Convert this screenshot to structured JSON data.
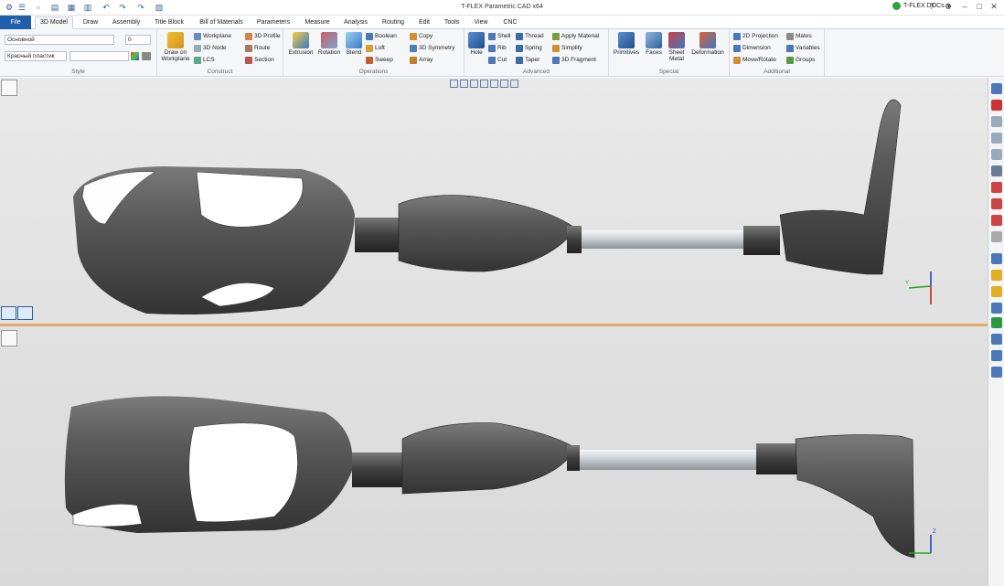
{
  "app_title": "T-FLEX Parametric CAD x64",
  "docs_label": "T-FLEX DOCs",
  "tabs": [
    "File",
    "3D Model",
    "Draw",
    "Assembly",
    "Title Block",
    "Bill of Materials",
    "Parameters",
    "Measure",
    "Analysis",
    "Routing",
    "Edit",
    "Tools",
    "View",
    "CNC"
  ],
  "active_tab": "3D Model",
  "style": {
    "layer": "Основной",
    "layer_num": "0",
    "material": "Красный пластик",
    "label": "Style"
  },
  "construct": {
    "big": "Draw on Workplane",
    "items": [
      "Workplane",
      "3D Node",
      "LCS",
      "3D Profile",
      "Route",
      "Section"
    ],
    "label": "Construct"
  },
  "operations": {
    "big": [
      "Extrusion",
      "Rotation",
      "Blend"
    ],
    "items": [
      "Boolean",
      "Loft",
      "Sweep",
      "Copy",
      "3D Symmetry",
      "Array"
    ],
    "label": "Operations"
  },
  "advanced": {
    "big": "Hole",
    "items": [
      "Shell",
      "Rib",
      "Cut",
      "Thread",
      "Spring",
      "Taper",
      "Apply Material",
      "Simplify",
      "3D Fragment"
    ],
    "label": "Advanced"
  },
  "special": {
    "big": [
      "Primitives",
      "Faces",
      "Sheet Metal",
      "Deformation"
    ],
    "label": "Special"
  },
  "additional": {
    "items": [
      "2D Projection",
      "Dimension",
      "Move/Rotate",
      "Mates",
      "Variables",
      "Groups"
    ],
    "label": "Additional"
  },
  "axis_labels": {
    "y": "Y",
    "z": "Z"
  },
  "colors": {
    "file_tab": "#1f5fa9",
    "divider": "#e6a86c",
    "accent": "#1f5fa9"
  }
}
